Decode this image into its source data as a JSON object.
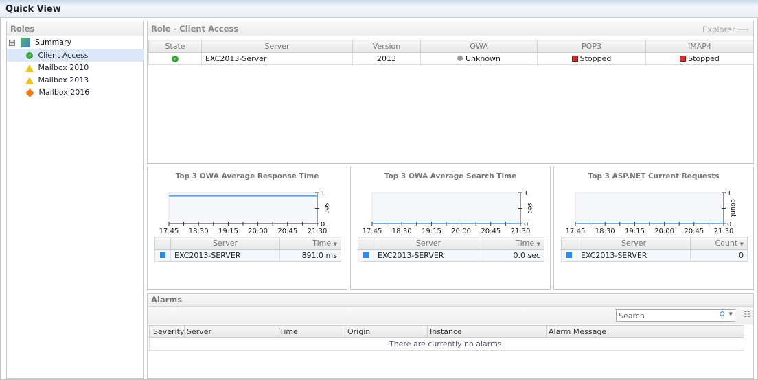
{
  "window": {
    "title": "Quick View"
  },
  "roles": {
    "title": "Roles",
    "items": [
      {
        "label": "Summary",
        "icon": "exchange-server-icon",
        "level": 0
      },
      {
        "label": "Client Access",
        "icon": "ok-icon",
        "level": 1,
        "selected": true
      },
      {
        "label": "Mailbox 2010",
        "icon": "warning-icon",
        "level": 1
      },
      {
        "label": "Mailbox 2013",
        "icon": "warning-icon",
        "level": 1
      },
      {
        "label": "Mailbox 2016",
        "icon": "critical-icon",
        "level": 1
      }
    ]
  },
  "role_panel": {
    "title": "Role - Client Access",
    "explorer_label": "Explorer",
    "columns": [
      "State",
      "Server",
      "Version",
      "OWA",
      "POP3",
      "IMAP4"
    ],
    "rows": [
      {
        "state": "ok",
        "server": "EXC2013-Server",
        "version": "2013",
        "owa": "Unknown",
        "pop3": "Stopped",
        "imap4": "Stopped"
      }
    ]
  },
  "charts_panels": [
    {
      "title": "Top 3 OWA Average Response Time",
      "unit": "sec",
      "col_server": "Server",
      "col_value": "Time",
      "row_server": "EXC2013-SERVER",
      "row_value": "891.0 ms"
    },
    {
      "title": "Top 3 OWA Average Search Time",
      "unit": "sec",
      "col_server": "Server",
      "col_value": "Time",
      "row_server": "EXC2013-SERVER",
      "row_value": "0.0 sec"
    },
    {
      "title": "Top 3 ASP.NET Current Requests",
      "unit": "count",
      "col_server": "Server",
      "col_value": "Count",
      "row_server": "EXC2013-SERVER",
      "row_value": "0"
    }
  ],
  "chart_data": [
    {
      "type": "line",
      "title": "Top 3 OWA Average Response Time",
      "ylabel": "sec",
      "xticks": [
        "17:45",
        "18:30",
        "19:15",
        "20:00",
        "20:45",
        "21:30"
      ],
      "ylim": [
        0,
        1
      ],
      "yticks": [
        "0",
        "1"
      ],
      "series": [
        {
          "color": "#2a8ae6",
          "x": [
            "17:45",
            "21:30"
          ],
          "values": [
            0.891,
            0.891
          ]
        }
      ]
    },
    {
      "type": "line",
      "title": "Top 3 OWA Average Search Time",
      "ylabel": "sec",
      "xticks": [
        "17:45",
        "18:30",
        "19:15",
        "20:00",
        "20:45",
        "21:30"
      ],
      "ylim": [
        0,
        1
      ],
      "yticks": [
        "0",
        "1"
      ],
      "series": [
        {
          "color": "#2a8ae6",
          "x": [
            "17:45",
            "21:30"
          ],
          "values": [
            0,
            0
          ]
        }
      ]
    },
    {
      "type": "line",
      "title": "Top 3 ASP.NET Current Requests",
      "ylabel": "count",
      "xticks": [
        "17:45",
        "18:30",
        "19:15",
        "20:00",
        "20:45",
        "21:30"
      ],
      "ylim": [
        0,
        1
      ],
      "yticks": [
        "0",
        "1"
      ],
      "series": [
        {
          "color": "#2a8ae6",
          "x": [
            "17:45",
            "21:30"
          ],
          "values": [
            0,
            0
          ]
        }
      ]
    }
  ],
  "alarms": {
    "title": "Alarms",
    "search_placeholder": "Search",
    "columns": [
      "Severity",
      "Server",
      "Time",
      "Origin",
      "Instance",
      "Alarm Message"
    ],
    "empty_text": "There are currently no alarms."
  }
}
